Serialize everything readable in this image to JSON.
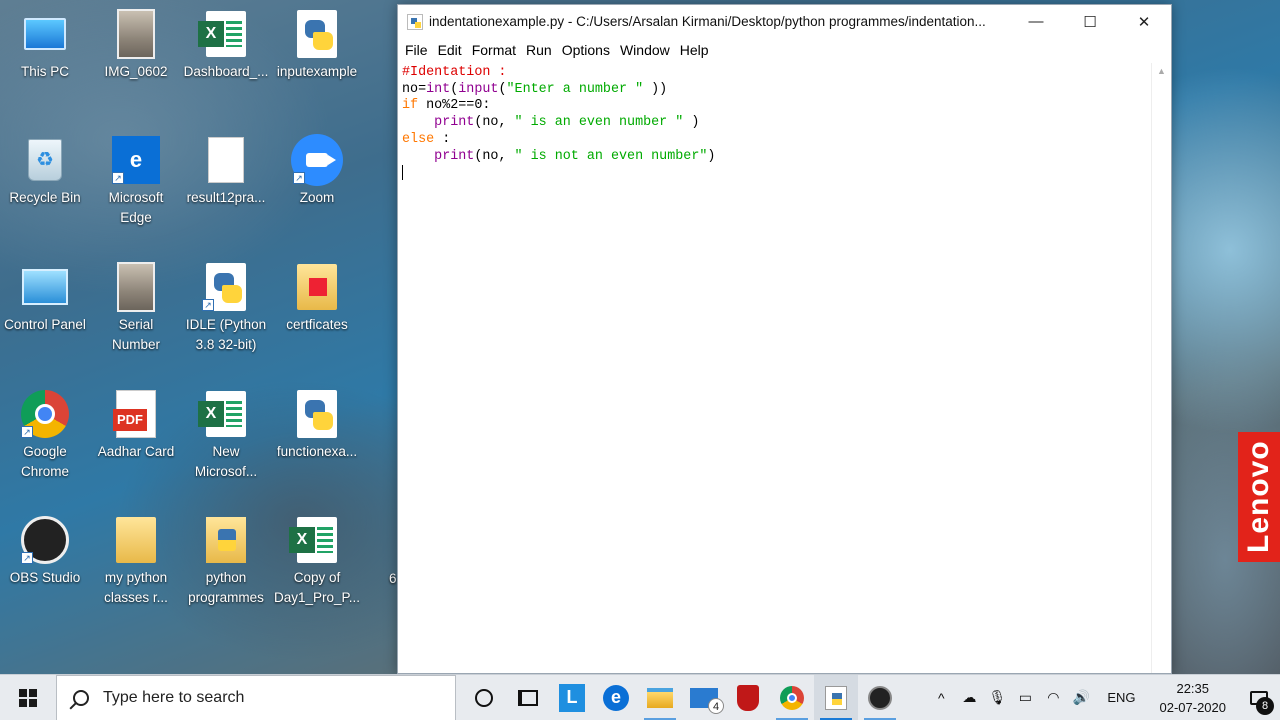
{
  "desktop": {
    "icons": [
      {
        "label": "This PC",
        "icon": "computer-icon"
      },
      {
        "label": "IMG_0602",
        "icon": "image-file-icon"
      },
      {
        "label": "Dashboard_...",
        "icon": "excel-file-icon"
      },
      {
        "label": "inputexample",
        "icon": "python-file-icon"
      },
      {
        "label": "Recycle Bin",
        "icon": "recycle-bin-icon"
      },
      {
        "label": "Microsoft Edge",
        "icon": "edge-icon"
      },
      {
        "label": "result12pra...",
        "icon": "document-icon"
      },
      {
        "label": "Zoom",
        "icon": "zoom-icon"
      },
      {
        "label": "Control Panel",
        "icon": "control-panel-icon"
      },
      {
        "label": "Serial Number",
        "icon": "image-file-icon"
      },
      {
        "label": "IDLE (Python 3.8 32-bit)",
        "icon": "python-idle-icon"
      },
      {
        "label": "certficates",
        "icon": "pdf-folder-icon"
      },
      {
        "label": "Google Chrome",
        "icon": "chrome-icon"
      },
      {
        "label": "Aadhar Card",
        "icon": "pdf-file-icon"
      },
      {
        "label": "New Microsof...",
        "icon": "excel-file-icon"
      },
      {
        "label": "functionexa...",
        "icon": "python-file-icon"
      },
      {
        "label": "OBS Studio",
        "icon": "obs-icon"
      },
      {
        "label": "my python classes r...",
        "icon": "folder-icon"
      },
      {
        "label": "python programmes",
        "icon": "python-folder-icon"
      },
      {
        "label": "Copy of Day1_Pro_P...",
        "icon": "excel-file-icon"
      }
    ],
    "partial_label": "6",
    "pdf_label": "PDF",
    "lenovo": "Lenovo"
  },
  "window": {
    "title": "indentationexample.py - C:/Users/Arsalan Kirmani/Desktop/python programmes/indentation...",
    "minimize": "—",
    "maximize": "☐",
    "close": "✕",
    "menu": [
      "File",
      "Edit",
      "Format",
      "Run",
      "Options",
      "Window",
      "Help"
    ],
    "code": [
      "#Identation :",
      "no=int(input(\"Enter a number \" ))",
      "if no%2==0:",
      "    print(no, \" is an even number \" )",
      "else :",
      "    print(no, \" is not an even number\")"
    ]
  },
  "taskbar": {
    "search_placeholder": "Type here to search",
    "mail_badge": "4",
    "language": "ENG",
    "time": "22:35",
    "date": "02-07-2020",
    "notification_count": "8",
    "l_label": "L",
    "e_label": "e"
  }
}
